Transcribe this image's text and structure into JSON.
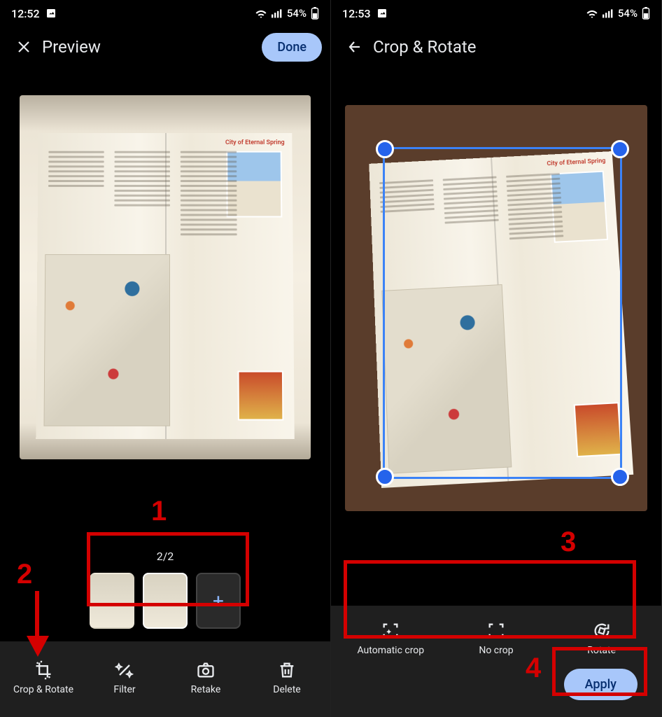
{
  "left": {
    "time": "12:52",
    "battery": "54%",
    "title": "Preview",
    "done": "Done",
    "page_counter": "2/2",
    "toolbar": {
      "crop": "Crop & Rotate",
      "filter": "Filter",
      "retake": "Retake",
      "delete": "Delete"
    },
    "book_heading": "City of Eternal Spring",
    "annotations": {
      "n1": "1",
      "n2": "2"
    }
  },
  "right": {
    "time": "12:53",
    "battery": "54%",
    "title": "Crop & Rotate",
    "options": {
      "auto": "Automatic crop",
      "none": "No crop",
      "rotate": "Rotate"
    },
    "apply": "Apply",
    "book_heading": "City of Eternal Spring",
    "annotations": {
      "n3": "3",
      "n4": "4"
    }
  }
}
